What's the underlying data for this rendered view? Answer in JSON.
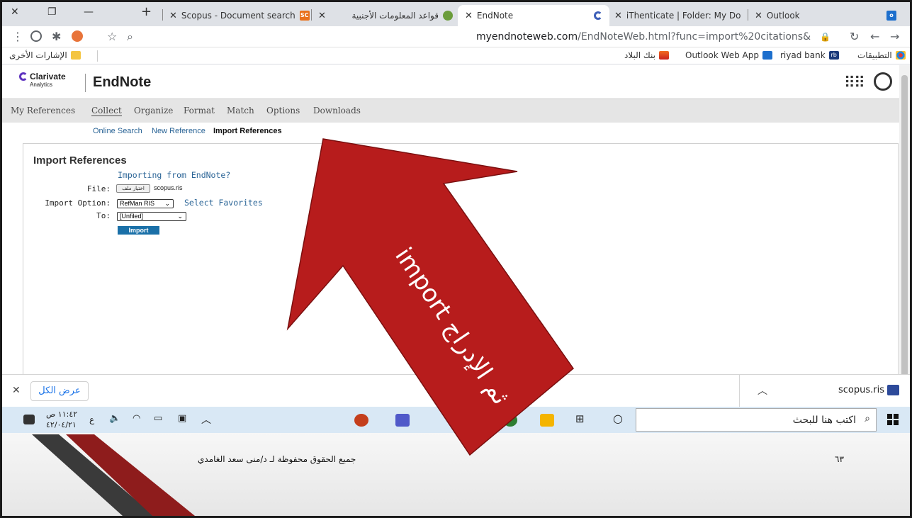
{
  "browser": {
    "tabs": [
      {
        "label": "Outlook",
        "icon": "outlook-icon"
      },
      {
        "label": "iThenticate | Folder: My Do",
        "icon": "ithenticate-icon"
      },
      {
        "label": "EndNote",
        "icon": "clarivate-icon"
      },
      {
        "label": "قواعد المعلومات الأجنبية",
        "icon": "db-icon"
      },
      {
        "label": "Scopus - Document search",
        "icon": "scopus-icon",
        "badge": "SC"
      }
    ],
    "url_host": "myendnoteweb.com",
    "url_path": "/EndNoteWeb.html?func=import%20citations&",
    "bookmarks": [
      {
        "label": "التطبيقات",
        "icon": "apps-grid-icon"
      },
      {
        "label": "riyad bank",
        "icon": "riyad-bank-icon",
        "badge": "rb"
      },
      {
        "label": "Outlook Web App",
        "icon": "outlook-icon"
      },
      {
        "label": "بنك البلاد",
        "icon": "albilad-icon"
      }
    ],
    "other_bookmarks": "الإشارات الأخرى"
  },
  "endnote": {
    "brand": "Clarivate",
    "brand_sub": "Analytics",
    "title": "EndNote",
    "nav": [
      "My References",
      "Collect",
      "Organize",
      "Format",
      "Match",
      "Options",
      "Downloads"
    ],
    "subnav": [
      "Online Search",
      "New Reference",
      "Import References"
    ],
    "import": {
      "heading": "Import References",
      "importing_link": "Importing from EndNote?",
      "file_label": "File:",
      "file_button": "اختيار ملف",
      "file_name": "scopus.ris",
      "option_label": "Import Option:",
      "option_value": "RefMan RIS",
      "select_favorites": "Select Favorites",
      "to_label": "To:",
      "to_value": "[Unfiled]",
      "import_button": "Import"
    }
  },
  "downloads": {
    "show_all": "عرض الكل",
    "file": "scopus.ris"
  },
  "taskbar": {
    "search_placeholder": "اكتب هنا للبحث",
    "time": "١١:٤٢ ص",
    "date": "٤٢/٠٤/٢١",
    "lang": "ع"
  },
  "slide": {
    "copyright": "جميع الحقوق محفوظة لـ د/منى سعد الغامدي",
    "page_number": "٦٣",
    "arrow_text": "import ثم الإدراج"
  },
  "colors": {
    "arrow": "#b71c1c",
    "link": "#2a6496",
    "import_button": "#1a70a8"
  }
}
